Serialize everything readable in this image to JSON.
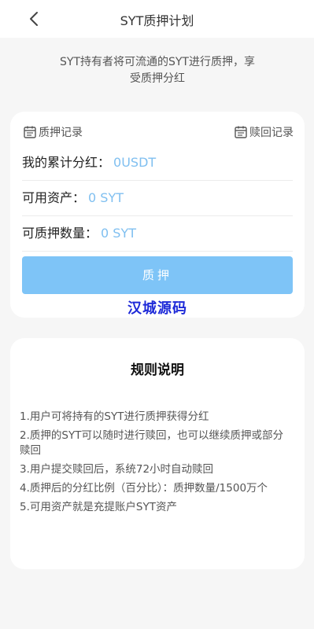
{
  "header": {
    "title": "SYT质押计划",
    "back_icon": "chevron-left-icon"
  },
  "intro": "SYT持有者将可流通的SYT进行质押，享受质押分红",
  "records": {
    "pledge_records": "质押记录",
    "redeem_records": "赎回记录",
    "icon": "calendar-icon"
  },
  "fields": [
    {
      "label": "我的累计分红：",
      "value": "0USDT"
    },
    {
      "label": "可用资产：",
      "value": "0 SYT"
    },
    {
      "label": "可质押数量：",
      "value": "0 SYT"
    }
  ],
  "pledge_button": "质押",
  "watermark": "汉城源码",
  "rules": {
    "title": "规则说明",
    "items": [
      "1.用户可将持有的SYT进行质押获得分红",
      "2.质押的SYT可以随时进行赎回，也可以继续质押或部分赎回",
      "3.用户提交赎回后，系统72小时自动赎回",
      "4.质押后的分红比例（百分比）：质押数量/1500万个",
      "5.可用资产就是充提账户SYT资产"
    ]
  },
  "colors": {
    "accent": "#7ec4f7",
    "value_text": "#7fbff0",
    "watermark": "#1e2ad8",
    "background": "#f6f6f6"
  }
}
